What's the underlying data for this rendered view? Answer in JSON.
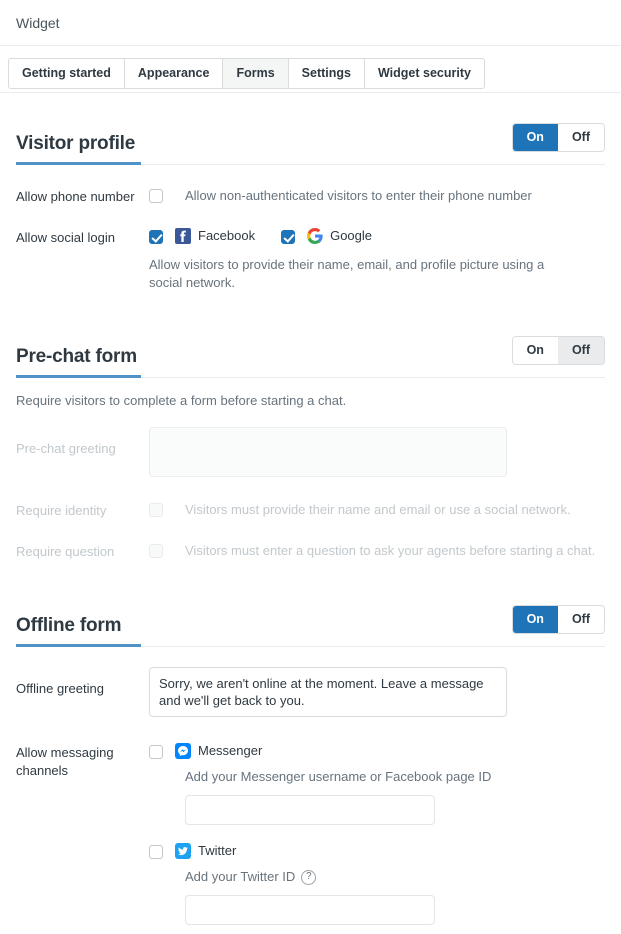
{
  "header": {
    "title": "Widget"
  },
  "tabs": [
    {
      "label": "Getting started",
      "active": false
    },
    {
      "label": "Appearance",
      "active": false
    },
    {
      "label": "Forms",
      "active": true
    },
    {
      "label": "Settings",
      "active": false
    },
    {
      "label": "Widget security",
      "active": false
    }
  ],
  "toggle": {
    "on_label": "On",
    "off_label": "Off"
  },
  "colors": {
    "accent_blue": "#1f73b7",
    "underline_blue": "#5293c7",
    "facebook_blue": "#3b5998",
    "messenger_blue": "#0084ff",
    "twitter_blue": "#1da1f2",
    "border_gray": "#d8dcde",
    "muted_text": "#68737d",
    "disabled_text": "#c2c8cc"
  },
  "visitor_profile": {
    "title": "Visitor profile",
    "state": "On",
    "phone": {
      "label": "Allow phone number",
      "checkbox_checked": false,
      "description": "Allow non-authenticated visitors to enter their phone number"
    },
    "social": {
      "label": "Allow social login",
      "providers": [
        {
          "name": "Facebook",
          "icon": "facebook-icon",
          "checked": true
        },
        {
          "name": "Google",
          "icon": "google-icon",
          "checked": true
        }
      ],
      "note": "Allow visitors to provide their name, email, and profile picture using a social network."
    }
  },
  "prechat_form": {
    "title": "Pre-chat form",
    "state": "Off",
    "description": "Require visitors to complete a form before starting a chat.",
    "greeting": {
      "label": "Pre-chat greeting",
      "value": "",
      "placeholder": ""
    },
    "require_identity": {
      "label": "Require identity",
      "checkbox_checked": false,
      "description": "Visitors must provide their name and email or use a social network."
    },
    "require_question": {
      "label": "Require question",
      "checkbox_checked": false,
      "description": "Visitors must enter a question to ask your agents before starting a chat."
    }
  },
  "offline_form": {
    "title": "Offline form",
    "state": "On",
    "greeting": {
      "label": "Offline greeting",
      "value": "Sorry, we aren't online at the moment. Leave a message and we'll get back to you."
    },
    "messaging_channels": {
      "label": "Allow messaging channels",
      "channels": [
        {
          "name": "Messenger",
          "icon": "messenger-icon",
          "checked": false,
          "hint": "Add your Messenger username or Facebook page ID",
          "input_value": "",
          "input_placeholder": ""
        },
        {
          "name": "Twitter",
          "icon": "twitter-icon",
          "checked": false,
          "hint": "Add your Twitter ID",
          "help_icon": "help-icon",
          "help_glyph": "?",
          "input_value": "",
          "input_placeholder": ""
        }
      ]
    }
  }
}
